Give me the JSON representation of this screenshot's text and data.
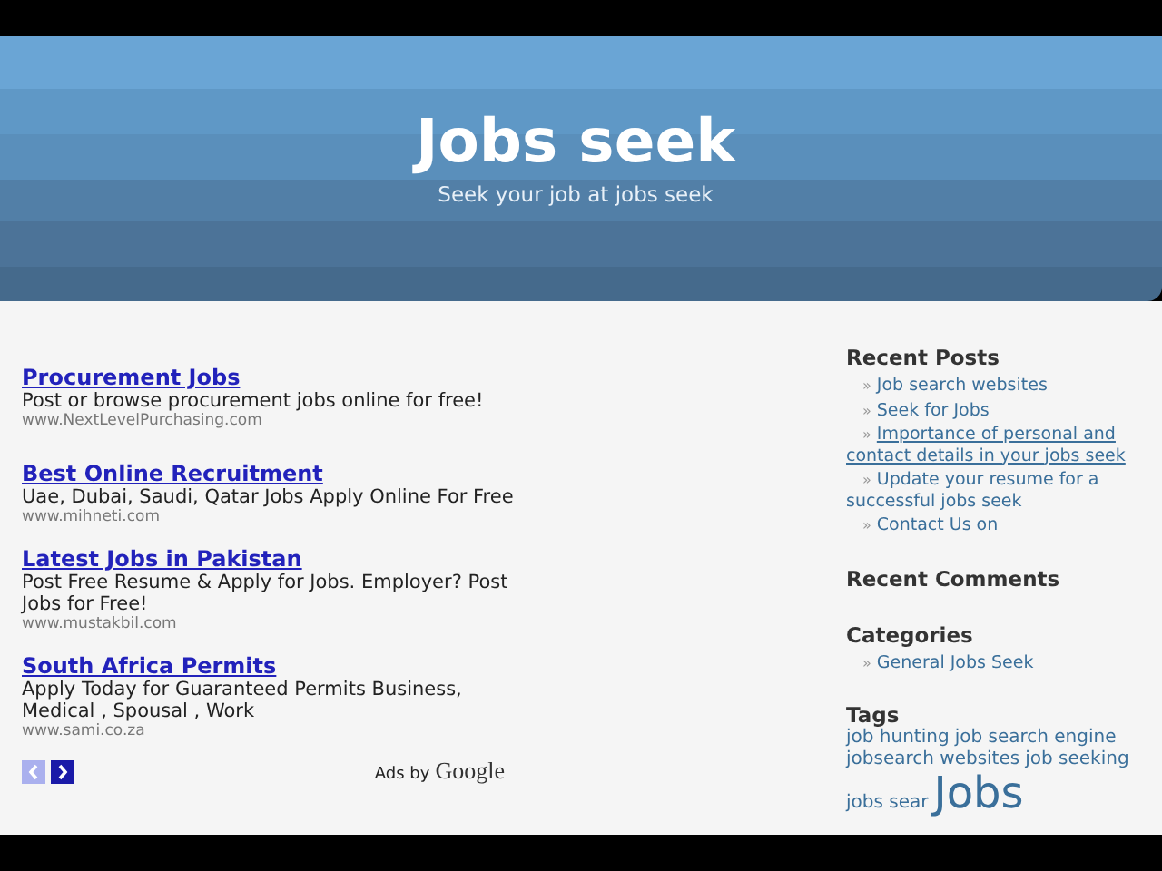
{
  "header": {
    "title": "Jobs seek",
    "subtitle": "Seek your job at jobs seek"
  },
  "ads": [
    {
      "title": "Procurement Jobs",
      "text": "Post or browse procurement jobs online for free!",
      "url": "www.NextLevelPurchasing.com"
    },
    {
      "title": "Best Online Recruitment",
      "text": "Uae, Dubai, Saudi, Qatar Jobs Apply Online For Free",
      "url": "www.mihneti.com"
    },
    {
      "title": "Latest Jobs in Pakistan",
      "text": "Post Free Resume & Apply for Jobs. Employer? Post Jobs for Free!",
      "url": "www.mustakbil.com"
    },
    {
      "title": "South Africa Permits",
      "text": "Apply Today for Guaranteed Permits Business, Medical , Spousal , Work",
      "url": "www.sami.co.za"
    }
  ],
  "ad_nav": {
    "prev_disabled": true,
    "next_disabled": false
  },
  "ads_by": {
    "label": "Ads by",
    "brand": "Google"
  },
  "sidebar": {
    "bullet": "»",
    "recent_posts": {
      "title": "Recent Posts",
      "items": [
        {
          "label": "Job search websites",
          "hovered": false
        },
        {
          "label": "Seek for Jobs",
          "hovered": false
        },
        {
          "label": "Importance of personal and contact details in your jobs seek",
          "hovered": true
        },
        {
          "label": "Update your resume for a successful jobs seek",
          "hovered": false
        },
        {
          "label": "Contact Us on",
          "hovered": false
        }
      ]
    },
    "recent_comments": {
      "title": "Recent Comments"
    },
    "categories": {
      "title": "Categories",
      "items": [
        {
          "label": "General Jobs Seek"
        }
      ]
    },
    "tags": {
      "title": "Tags",
      "items": [
        {
          "label": "job hunting",
          "kind": "small"
        },
        {
          "label": "job search engine",
          "kind": "small"
        },
        {
          "label": "jobsearch websites",
          "kind": "small"
        },
        {
          "label": "job seeking",
          "kind": "small"
        },
        {
          "label": "jobs sear",
          "kind": "small"
        },
        {
          "label": "Jobs",
          "kind": "large"
        }
      ]
    }
  }
}
